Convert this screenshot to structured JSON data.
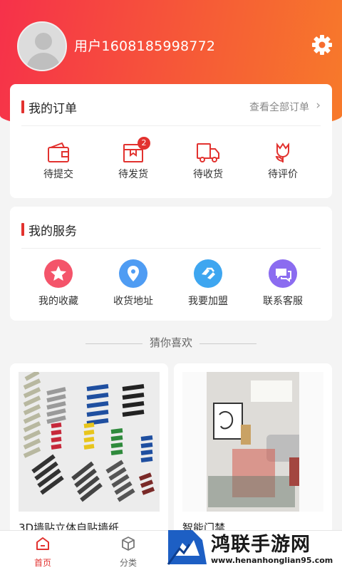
{
  "profile": {
    "username": "用户1608185998772"
  },
  "orders": {
    "title": "我的订单",
    "view_all": "查看全部订单",
    "items": [
      {
        "label": "待提交",
        "icon": "wallet-icon"
      },
      {
        "label": "待发货",
        "icon": "box-icon",
        "badge": "2"
      },
      {
        "label": "待收货",
        "icon": "truck-icon"
      },
      {
        "label": "待评价",
        "icon": "flower-icon"
      }
    ]
  },
  "services": {
    "title": "我的服务",
    "items": [
      {
        "label": "我的收藏",
        "icon": "star-icon",
        "color": "#f4546a"
      },
      {
        "label": "收货地址",
        "icon": "location-icon",
        "color": "#4f9cf3"
      },
      {
        "label": "我要加盟",
        "icon": "handshake-icon",
        "color": "#3ea6f0"
      },
      {
        "label": "联系客服",
        "icon": "chat-icon",
        "color": "#8b6cf0"
      }
    ]
  },
  "recommend": {
    "title": "猜你喜欢",
    "products": [
      {
        "name": "3D墙贴立体自贴墙纸"
      },
      {
        "name": "智能门禁"
      }
    ]
  },
  "tabbar": {
    "tabs": [
      {
        "label": "首页",
        "active": true
      },
      {
        "label": "分类",
        "active": false
      }
    ]
  },
  "watermark": {
    "brand": "鸿联手游网",
    "url": "www.henanhonglian95.com"
  },
  "colors": {
    "accent": "#e2322f",
    "hero_start": "#f6314a",
    "hero_end": "#f77a2a"
  }
}
